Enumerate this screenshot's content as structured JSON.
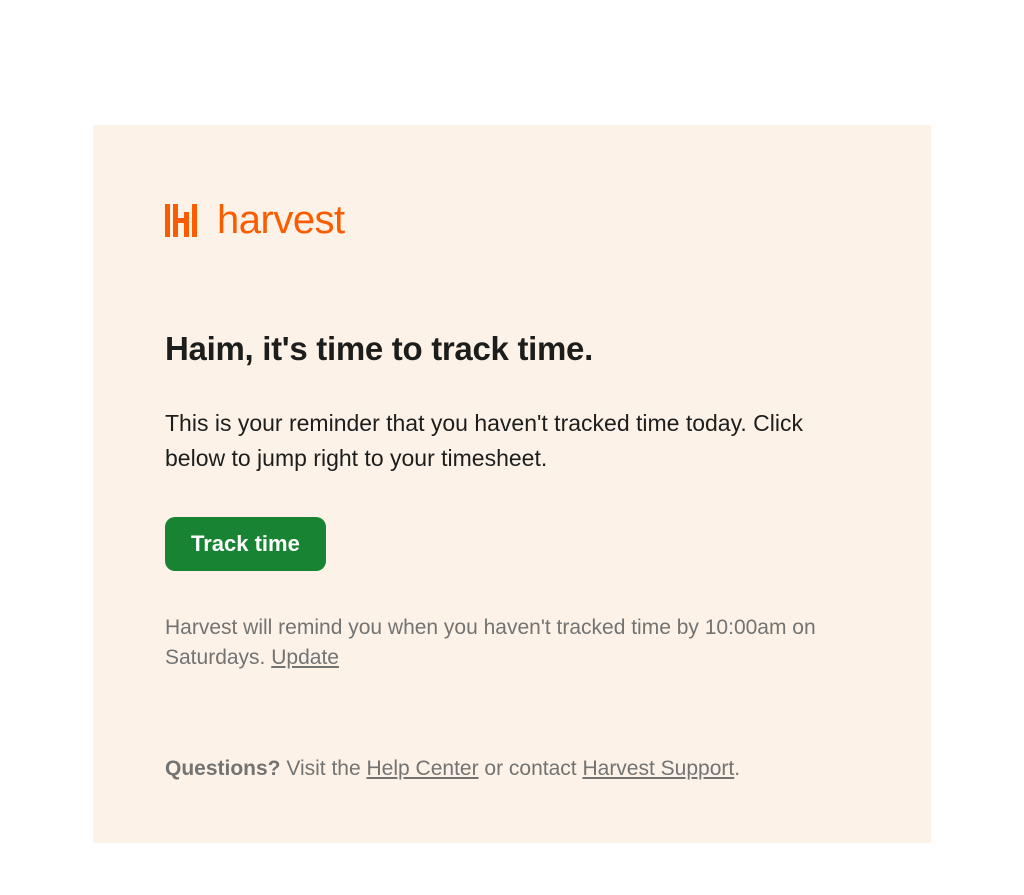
{
  "logo": {
    "brand_name": "harvest"
  },
  "heading": "Haim,  it's time to track time.",
  "body": "This is your reminder that you haven't tracked time today. Click below to jump right to your timesheet.",
  "cta_label": "Track time",
  "reminder": {
    "text_before": "Harvest will remind you when you haven't tracked time by 10:00am on Saturdays. ",
    "update_link": "Update"
  },
  "footer": {
    "questions_label": "Questions?",
    "text_before_help": " Visit the ",
    "help_center_link": "Help Center",
    "text_middle": " or contact ",
    "support_link": "Harvest Support",
    "text_after": "."
  },
  "colors": {
    "brand_orange": "#fa5d00",
    "cta_green": "#188433",
    "bg_cream": "#fcf2e8",
    "text_dark": "#1d1e1c",
    "text_muted": "#737371"
  }
}
